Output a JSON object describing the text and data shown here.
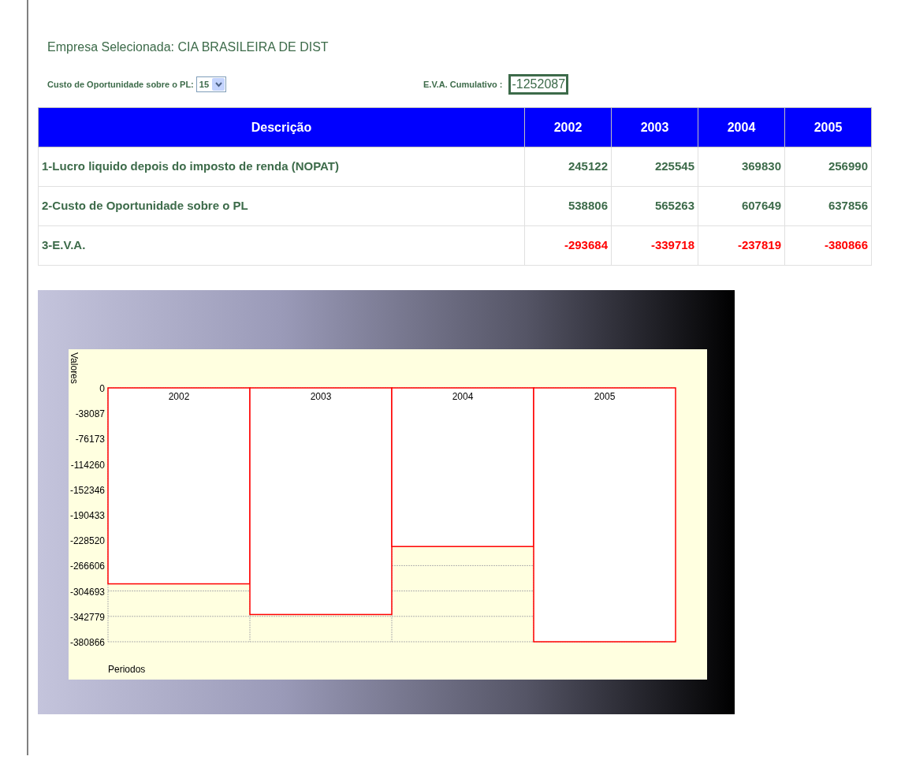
{
  "company_heading": "Empresa Selecionada: CIA BRASILEIRA DE DIST",
  "cost_selector": {
    "label": "Custo de Oportunidade sobre o PL:",
    "value": "15"
  },
  "eva_cumulative": {
    "label": "E.V.A. Cumulativo :",
    "value": "-1252087"
  },
  "table": {
    "columns": [
      "Descrição",
      "2002",
      "2003",
      "2004",
      "2005"
    ],
    "rows": [
      {
        "kind": "normal",
        "cells": [
          "1-Lucro liquido depois do imposto de renda (NOPAT)",
          "245122",
          "225545",
          "369830",
          "256990"
        ]
      },
      {
        "kind": "normal",
        "cells": [
          "2-Custo de Oportunidade sobre o PL",
          "538806",
          "565263",
          "607649",
          "637856"
        ]
      },
      {
        "kind": "negative",
        "cells": [
          "3-E.V.A.",
          "-293684",
          "-339718",
          "-237819",
          "-380866"
        ]
      }
    ]
  },
  "chart": {
    "chart_data": {
      "type": "bar",
      "xlabel": "Periodos",
      "ylabel": "Valores",
      "categories": [
        "2002",
        "2003",
        "2004",
        "2005"
      ],
      "series": [
        {
          "color": "#ff0000",
          "values": [
            -294000,
            -340000,
            -238000,
            -380866
          ]
        }
      ],
      "grid": true,
      "ylim": [
        -380866,
        0
      ],
      "yticks": [
        0,
        -38087,
        -76173,
        -114260,
        -152346,
        -190433,
        -228520,
        -266606,
        -304693,
        -342779,
        -380866
      ]
    }
  }
}
